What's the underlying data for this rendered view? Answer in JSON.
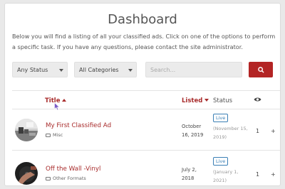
{
  "page": {
    "title": "Dashboard",
    "intro": "Below you will find a listing of all your classified ads. Click on one of the options to perform a specific task. If you have any questions, please contact the site administrator."
  },
  "filters": {
    "status_value": "Any Status",
    "category_value": "All Categories",
    "search_placeholder": "Search..."
  },
  "table": {
    "headers": {
      "title": "Title",
      "listed": "Listed",
      "status": "Status",
      "views_icon": "eye-icon"
    },
    "rows": [
      {
        "title": "My First Classified Ad",
        "category": "Misc",
        "listed_line1": "October",
        "listed_line2": "16, 2019",
        "status": "Live",
        "expires_line1": "(November 15,",
        "expires_line2": "2019)",
        "views": "1",
        "action": "+"
      },
      {
        "title": "Off the Wall -Vinyl",
        "category": "Other Formats",
        "listed_line1": "July 2,",
        "listed_line2": "2018",
        "status": "Live",
        "expires_line1": "(January 1,",
        "expires_line2": "2021)",
        "views": "1",
        "action": "+"
      }
    ]
  },
  "colors": {
    "accent": "#b32424",
    "link": "#a82b2b",
    "badge": "#3a7fb5"
  }
}
